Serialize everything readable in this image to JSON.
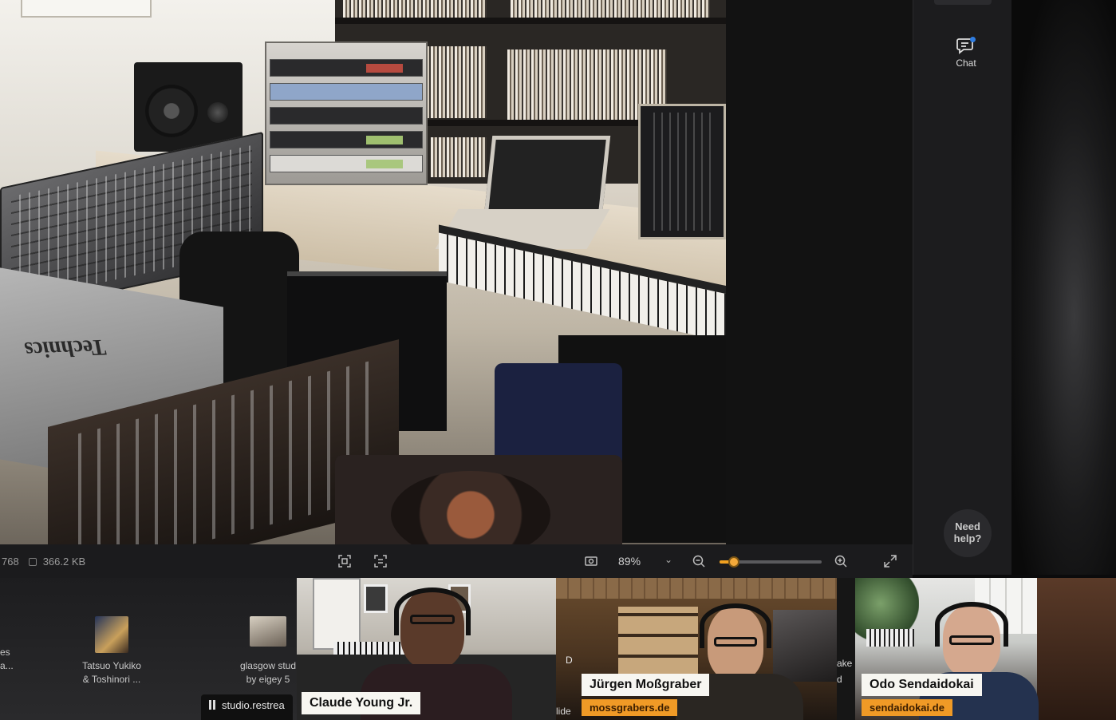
{
  "viewer": {
    "meta_dims": "768",
    "meta_size": "366.2 KB",
    "zoom_value": "89%",
    "zoom_level": 0.14
  },
  "sidebar": {
    "chat_label": "Chat",
    "help_line1": "Need",
    "help_line2": "help?"
  },
  "file_strip": {
    "items": [
      {
        "line1": "es",
        "line2": "a..."
      },
      {
        "line1": "Tatsuo Yukiko",
        "line2": "& Toshinori ..."
      },
      {
        "line1": "glasgow stud",
        "line2": "by eigey 5"
      }
    ],
    "status_text": "studio.restrea"
  },
  "participants": [
    {
      "name": "Claude Young Jr.",
      "url": ""
    },
    {
      "name": "Jürgen Moßgraber",
      "url": "mossgrabers.de"
    },
    {
      "name": "Odo Sendaidokai",
      "url": "sendaidokai.de"
    }
  ],
  "tile_fragments": {
    "left_edge_letter": "D",
    "right_fragment1": "ake",
    "right_fragment2": "d",
    "left_fragment": "lide"
  },
  "colors": {
    "accent_orange": "#f09a26",
    "chat_badge_blue": "#2f7de1"
  }
}
